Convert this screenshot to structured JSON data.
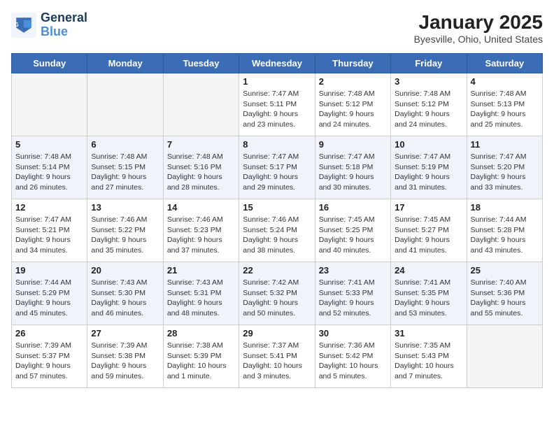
{
  "logo": {
    "line1": "General",
    "line2": "Blue"
  },
  "title": "January 2025",
  "location": "Byesville, Ohio, United States",
  "days_of_week": [
    "Sunday",
    "Monday",
    "Tuesday",
    "Wednesday",
    "Thursday",
    "Friday",
    "Saturday"
  ],
  "weeks": [
    [
      {
        "day": "",
        "content": ""
      },
      {
        "day": "",
        "content": ""
      },
      {
        "day": "",
        "content": ""
      },
      {
        "day": "1",
        "content": "Sunrise: 7:47 AM\nSunset: 5:11 PM\nDaylight: 9 hours\nand 23 minutes."
      },
      {
        "day": "2",
        "content": "Sunrise: 7:48 AM\nSunset: 5:12 PM\nDaylight: 9 hours\nand 24 minutes."
      },
      {
        "day": "3",
        "content": "Sunrise: 7:48 AM\nSunset: 5:12 PM\nDaylight: 9 hours\nand 24 minutes."
      },
      {
        "day": "4",
        "content": "Sunrise: 7:48 AM\nSunset: 5:13 PM\nDaylight: 9 hours\nand 25 minutes."
      }
    ],
    [
      {
        "day": "5",
        "content": "Sunrise: 7:48 AM\nSunset: 5:14 PM\nDaylight: 9 hours\nand 26 minutes."
      },
      {
        "day": "6",
        "content": "Sunrise: 7:48 AM\nSunset: 5:15 PM\nDaylight: 9 hours\nand 27 minutes."
      },
      {
        "day": "7",
        "content": "Sunrise: 7:48 AM\nSunset: 5:16 PM\nDaylight: 9 hours\nand 28 minutes."
      },
      {
        "day": "8",
        "content": "Sunrise: 7:47 AM\nSunset: 5:17 PM\nDaylight: 9 hours\nand 29 minutes."
      },
      {
        "day": "9",
        "content": "Sunrise: 7:47 AM\nSunset: 5:18 PM\nDaylight: 9 hours\nand 30 minutes."
      },
      {
        "day": "10",
        "content": "Sunrise: 7:47 AM\nSunset: 5:19 PM\nDaylight: 9 hours\nand 31 minutes."
      },
      {
        "day": "11",
        "content": "Sunrise: 7:47 AM\nSunset: 5:20 PM\nDaylight: 9 hours\nand 33 minutes."
      }
    ],
    [
      {
        "day": "12",
        "content": "Sunrise: 7:47 AM\nSunset: 5:21 PM\nDaylight: 9 hours\nand 34 minutes."
      },
      {
        "day": "13",
        "content": "Sunrise: 7:46 AM\nSunset: 5:22 PM\nDaylight: 9 hours\nand 35 minutes."
      },
      {
        "day": "14",
        "content": "Sunrise: 7:46 AM\nSunset: 5:23 PM\nDaylight: 9 hours\nand 37 minutes."
      },
      {
        "day": "15",
        "content": "Sunrise: 7:46 AM\nSunset: 5:24 PM\nDaylight: 9 hours\nand 38 minutes."
      },
      {
        "day": "16",
        "content": "Sunrise: 7:45 AM\nSunset: 5:25 PM\nDaylight: 9 hours\nand 40 minutes."
      },
      {
        "day": "17",
        "content": "Sunrise: 7:45 AM\nSunset: 5:27 PM\nDaylight: 9 hours\nand 41 minutes."
      },
      {
        "day": "18",
        "content": "Sunrise: 7:44 AM\nSunset: 5:28 PM\nDaylight: 9 hours\nand 43 minutes."
      }
    ],
    [
      {
        "day": "19",
        "content": "Sunrise: 7:44 AM\nSunset: 5:29 PM\nDaylight: 9 hours\nand 45 minutes."
      },
      {
        "day": "20",
        "content": "Sunrise: 7:43 AM\nSunset: 5:30 PM\nDaylight: 9 hours\nand 46 minutes."
      },
      {
        "day": "21",
        "content": "Sunrise: 7:43 AM\nSunset: 5:31 PM\nDaylight: 9 hours\nand 48 minutes."
      },
      {
        "day": "22",
        "content": "Sunrise: 7:42 AM\nSunset: 5:32 PM\nDaylight: 9 hours\nand 50 minutes."
      },
      {
        "day": "23",
        "content": "Sunrise: 7:41 AM\nSunset: 5:33 PM\nDaylight: 9 hours\nand 52 minutes."
      },
      {
        "day": "24",
        "content": "Sunrise: 7:41 AM\nSunset: 5:35 PM\nDaylight: 9 hours\nand 53 minutes."
      },
      {
        "day": "25",
        "content": "Sunrise: 7:40 AM\nSunset: 5:36 PM\nDaylight: 9 hours\nand 55 minutes."
      }
    ],
    [
      {
        "day": "26",
        "content": "Sunrise: 7:39 AM\nSunset: 5:37 PM\nDaylight: 9 hours\nand 57 minutes."
      },
      {
        "day": "27",
        "content": "Sunrise: 7:39 AM\nSunset: 5:38 PM\nDaylight: 9 hours\nand 59 minutes."
      },
      {
        "day": "28",
        "content": "Sunrise: 7:38 AM\nSunset: 5:39 PM\nDaylight: 10 hours\nand 1 minute."
      },
      {
        "day": "29",
        "content": "Sunrise: 7:37 AM\nSunset: 5:41 PM\nDaylight: 10 hours\nand 3 minutes."
      },
      {
        "day": "30",
        "content": "Sunrise: 7:36 AM\nSunset: 5:42 PM\nDaylight: 10 hours\nand 5 minutes."
      },
      {
        "day": "31",
        "content": "Sunrise: 7:35 AM\nSunset: 5:43 PM\nDaylight: 10 hours\nand 7 minutes."
      },
      {
        "day": "",
        "content": ""
      }
    ]
  ]
}
